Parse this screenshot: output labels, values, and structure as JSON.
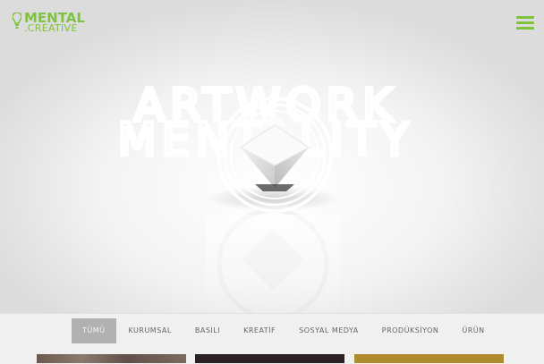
{
  "brand": {
    "line1": "MENTAL",
    "line2": ".CREATIVE",
    "color": "#7fc23f"
  },
  "menu": {
    "icon": "hamburger-menu-icon"
  },
  "hero": {
    "title_line1": "ARTWORK",
    "title_line2": "MENTALITY",
    "emblem_icon": "diamond-emblem-icon"
  },
  "filters": {
    "items": [
      "TÜMÜ",
      "KURUMSAL",
      "BASILI",
      "KREATİF",
      "SOSYAL MEDYA",
      "PRODÜKSİYON",
      "ÜRÜN"
    ],
    "active_index": 0
  },
  "colors": {
    "accent": "#7fc23f",
    "active_tab_bg": "#b1b1b1"
  }
}
